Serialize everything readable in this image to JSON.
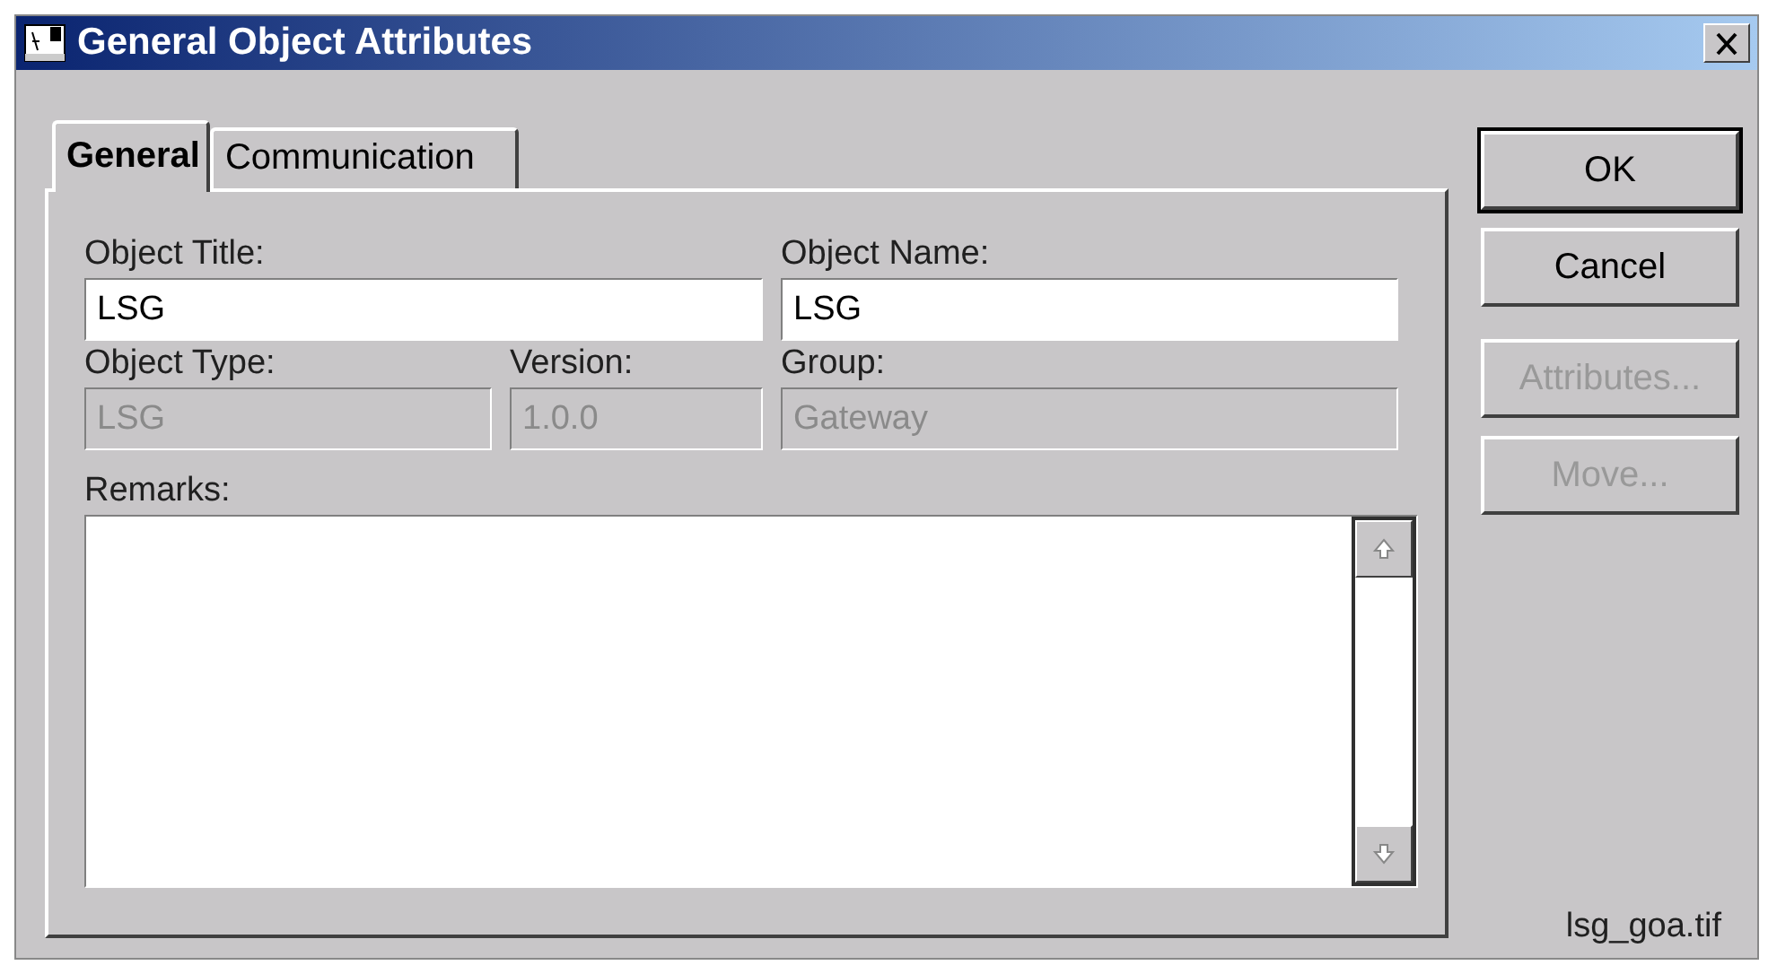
{
  "window": {
    "title": "General Object Attributes"
  },
  "tabs": [
    {
      "label": "General",
      "selected": true
    },
    {
      "label": "Communication",
      "selected": false
    }
  ],
  "fields": [
    {
      "label": "Object Title:",
      "value": "LSG",
      "disabled": false
    },
    {
      "label": "Object Name:",
      "value": "LSG",
      "disabled": false
    },
    {
      "label": "Object Type:",
      "value": "LSG",
      "disabled": true
    },
    {
      "label": "Version:",
      "value": "1.0.0",
      "disabled": true
    },
    {
      "label": "Group:",
      "value": "Gateway",
      "disabled": true
    }
  ],
  "remarks": {
    "label": "Remarks:"
  },
  "buttons": [
    {
      "label": "OK",
      "disabled": false,
      "default": true
    },
    {
      "label": "Cancel",
      "disabled": false,
      "default": false
    },
    {
      "label": "Attributes...",
      "disabled": true,
      "default": false
    },
    {
      "label": "Move...",
      "disabled": true,
      "default": false
    }
  ],
  "caption": "lsg_goa.tif"
}
